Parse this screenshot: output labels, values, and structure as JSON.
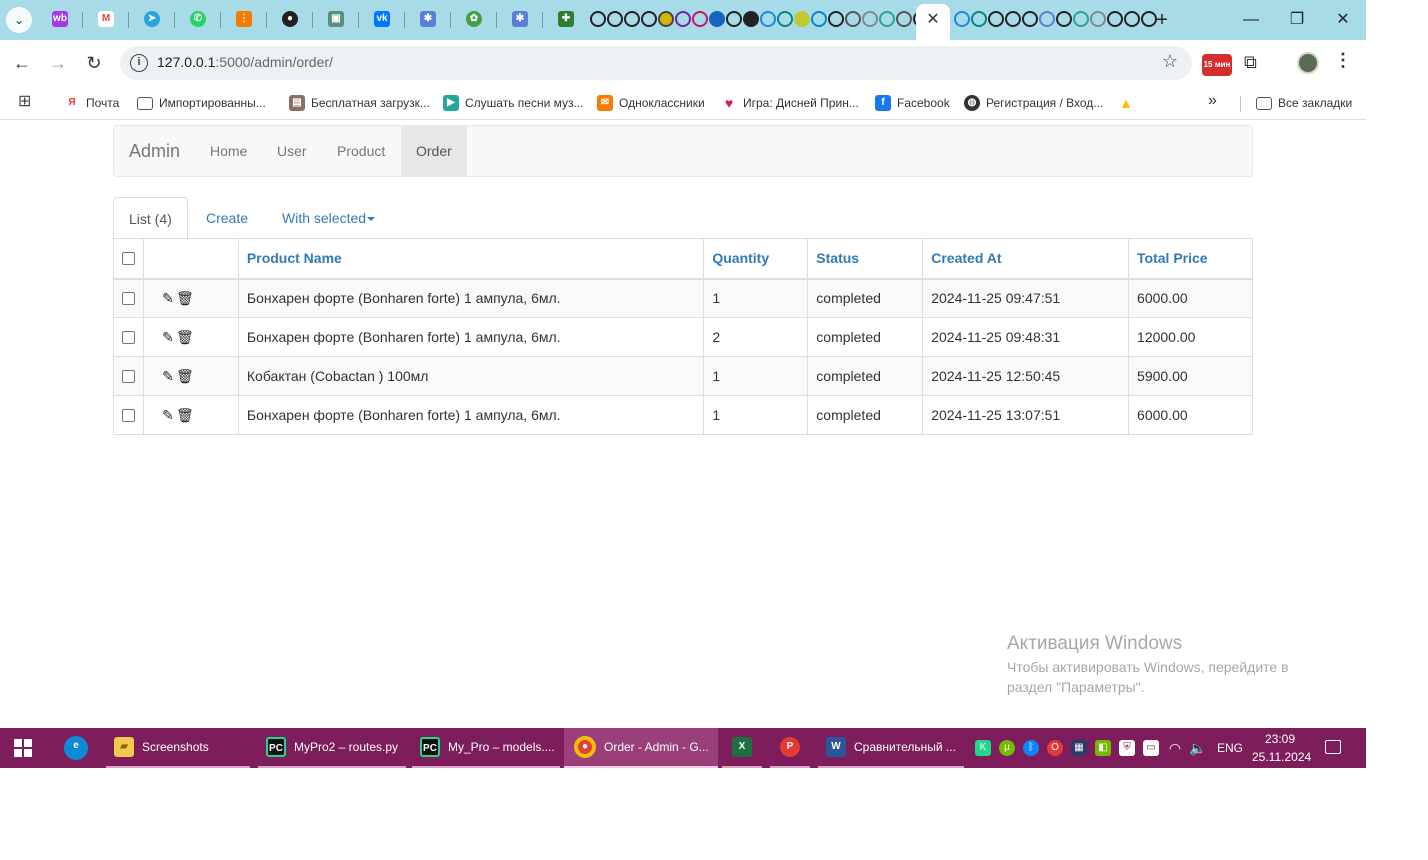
{
  "browser": {
    "active_tab_close": "✕",
    "new_tab": "+",
    "window_controls": {
      "minimize": "—",
      "restore": "❐",
      "close": "✕"
    },
    "url_host": "127.0.0.1",
    "url_path": ":5000/admin/order/",
    "extension_badge": "15 мин",
    "bookmarks": [
      {
        "label": "Почта",
        "icon": "yandex-icon",
        "color": "#e53935"
      },
      {
        "label": "Импортированны...",
        "icon": "folder-icon",
        "color": "#555555"
      },
      {
        "label": "Бесплатная загрузк...",
        "icon": "image-icon",
        "color": "#8d6e63"
      },
      {
        "label": "Слушать песни муз...",
        "icon": "play-icon",
        "color": "#26a69a"
      },
      {
        "label": "Одноклассники",
        "icon": "ok-icon",
        "color": "#f57c00"
      },
      {
        "label": "Игра: Дисней Прин...",
        "icon": "heart-icon",
        "color": "#d81b60"
      },
      {
        "label": "Facebook",
        "icon": "facebook-icon",
        "color": "#1877f2"
      },
      {
        "label": "Регистрация / Вход...",
        "icon": "globe-icon",
        "color": "#333333"
      },
      {
        "label": "",
        "icon": "drive-icon",
        "color": "#fbbc04"
      }
    ],
    "all_bookmarks": "Все закладки"
  },
  "admin": {
    "brand": "Admin",
    "nav": [
      "Home",
      "User",
      "Product",
      "Order"
    ],
    "active_nav": "Order",
    "tabs": {
      "list": "List (4)",
      "create": "Create",
      "with_selected": "With selected"
    },
    "table": {
      "columns": [
        "Product Name",
        "Quantity",
        "Status",
        "Created At",
        "Total Price"
      ],
      "rows": [
        {
          "product": "Бонхарен форте (Bonharen forte) 1 ампула, 6мл.",
          "quantity": "1",
          "status": "completed",
          "created": "2024-11-25 09:47:51",
          "total": "6000.00"
        },
        {
          "product": "Бонхарен форте (Bonharen forte) 1 ампула, 6мл.",
          "quantity": "2",
          "status": "completed",
          "created": "2024-11-25 09:48:31",
          "total": "12000.00"
        },
        {
          "product": "Кобактан (Cobactan ) 100мл",
          "quantity": "1",
          "status": "completed",
          "created": "2024-11-25 12:50:45",
          "total": "5900.00"
        },
        {
          "product": "Бонхарен форте (Bonharen forte) 1 ампула, 6мл.",
          "quantity": "1",
          "status": "completed",
          "created": "2024-11-25 13:07:51",
          "total": "6000.00"
        }
      ]
    }
  },
  "watermark": {
    "title": "Активация Windows",
    "subtitle": "Чтобы активировать Windows, перейдите в раздел \"Параметры\"."
  },
  "taskbar": {
    "apps": [
      {
        "label": "Screenshots",
        "icon": "folder-icon",
        "color": "#f2c94c"
      },
      {
        "label": "MyPro2 – routes.py",
        "icon": "pycharm-icon",
        "color": "#21d789"
      },
      {
        "label": "My_Pro – models....",
        "icon": "pycharm-icon",
        "color": "#21d789"
      },
      {
        "label": "Order - Admin - G...",
        "icon": "chrome-icon",
        "color": "#db4437"
      },
      {
        "label": "",
        "icon": "excel-icon",
        "color": "#1d6f42"
      },
      {
        "label": "",
        "icon": "p-app-icon",
        "color": "#e53935"
      },
      {
        "label": "Сравнительный ...",
        "icon": "word-icon",
        "color": "#2b579a"
      }
    ],
    "language": "ENG",
    "time": "23:09",
    "date": "25.11.2024"
  }
}
